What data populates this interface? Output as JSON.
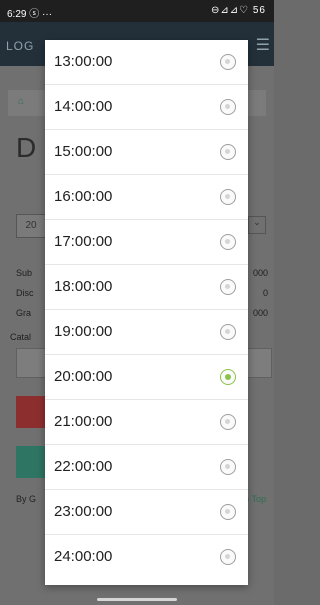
{
  "status_bar": {
    "time": "6:29",
    "extra": "···",
    "icons": "⊖⊿⊿♡ 56"
  },
  "background": {
    "logo": "LOG",
    "title_fragment": "D",
    "select_fragment": "20",
    "rows": [
      {
        "label": "Sub",
        "value": "000"
      },
      {
        "label": "Disc",
        "value": "0"
      },
      {
        "label": "Gra",
        "value": "000"
      }
    ],
    "catalog_label": "Catal",
    "footer_left": "By G",
    "footer_right": "o Top"
  },
  "dialog": {
    "options": [
      {
        "label": "13:00:00",
        "selected": false
      },
      {
        "label": "14:00:00",
        "selected": false
      },
      {
        "label": "15:00:00",
        "selected": false
      },
      {
        "label": "16:00:00",
        "selected": false
      },
      {
        "label": "17:00:00",
        "selected": false
      },
      {
        "label": "18:00:00",
        "selected": false
      },
      {
        "label": "19:00:00",
        "selected": false
      },
      {
        "label": "20:00:00",
        "selected": true
      },
      {
        "label": "21:00:00",
        "selected": false
      },
      {
        "label": "22:00:00",
        "selected": false
      },
      {
        "label": "23:00:00",
        "selected": false
      },
      {
        "label": "24:00:00",
        "selected": false
      }
    ]
  },
  "colors": {
    "accent": "#8bc34a",
    "header": "#23303a"
  }
}
